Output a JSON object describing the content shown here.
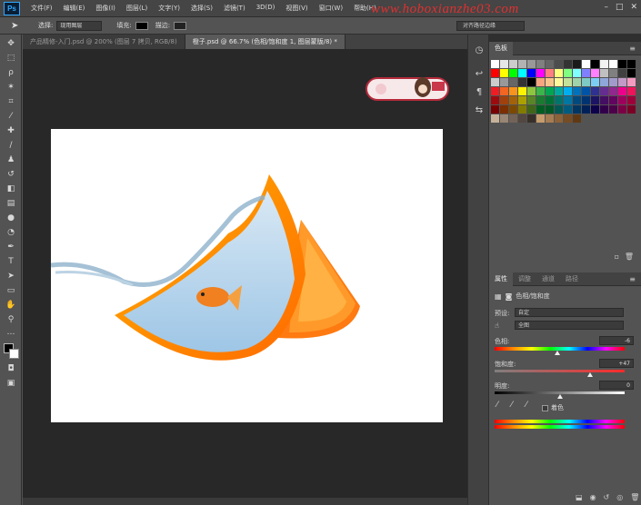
{
  "app": {
    "logo": "Ps",
    "watermark": "www.hoboxianzhe03.com"
  },
  "menu": [
    "文件(F)",
    "编辑(E)",
    "图像(I)",
    "图层(L)",
    "文字(Y)",
    "选择(S)",
    "滤镜(T)",
    "3D(D)",
    "视图(V)",
    "窗口(W)",
    "帮助(H)"
  ],
  "options": {
    "select_label": "选择:",
    "select_value": "现用图层",
    "fill_label": "填充:",
    "stroke_label": "描边:",
    "right_field": "对齐路径边缘"
  },
  "tabs": [
    {
      "label": "产品精修-入门.psd @ 200% (图层 7 拷贝, RGB/8)"
    },
    {
      "label": "橙子.psd @ 66.7% (色相/饱和度 1, 图层蒙版/8) *",
      "active": true
    }
  ],
  "swatches_panel": {
    "tab": "色板"
  },
  "swatch_colors": [
    "#ffffff",
    "#e6e6e6",
    "#cccccc",
    "#b3b3b3",
    "#999999",
    "#808080",
    "#666666",
    "#4d4d4d",
    "#333333",
    "#1a1a1a",
    "#ffffff",
    "#000000",
    "#f2f2f2",
    "#ffffff",
    "#000000",
    "#000000",
    "#ff0000",
    "#ffff00",
    "#00ff00",
    "#00ffff",
    "#0000ff",
    "#ff00ff",
    "#ff8080",
    "#ffff80",
    "#80ff80",
    "#80ffff",
    "#8080ff",
    "#ff80ff",
    "#c0c0c0",
    "#808080",
    "#404040",
    "#000000",
    "#cccccc",
    "#999999",
    "#666666",
    "#333333",
    "#000000",
    "#f5a57f",
    "#f7c58b",
    "#fff79a",
    "#c3e199",
    "#9fd3a9",
    "#7dcbc4",
    "#7ccdf4",
    "#8fa6d8",
    "#a39acc",
    "#c299c7",
    "#f39ac1",
    "#ee1d24",
    "#f26522",
    "#f7941d",
    "#fff200",
    "#8dc63f",
    "#39b54a",
    "#00a651",
    "#00a99d",
    "#00aeef",
    "#0072bc",
    "#0054a6",
    "#2e3192",
    "#662d91",
    "#92278f",
    "#ec008c",
    "#ed145b",
    "#9e0b0f",
    "#a0410d",
    "#a36209",
    "#aba000",
    "#598527",
    "#1a7b30",
    "#007236",
    "#00746b",
    "#0076a3",
    "#004a80",
    "#003471",
    "#1b1464",
    "#440e62",
    "#630460",
    "#9e005d",
    "#9e0039",
    "#790000",
    "#7b2e00",
    "#7d4900",
    "#827b00",
    "#406618",
    "#005e20",
    "#005826",
    "#005952",
    "#005b7f",
    "#003663",
    "#002157",
    "#0d004c",
    "#32004b",
    "#4b0049",
    "#7b0046",
    "#7a0026",
    "#c7b299",
    "#998675",
    "#736357",
    "#534741",
    "#37302a",
    "#c69c6d",
    "#a67c52",
    "#8c6239",
    "#754c24",
    "#603913"
  ],
  "properties": {
    "tabs": [
      "属性",
      "调整",
      "通道",
      "路径"
    ],
    "title": "色相/饱和度",
    "preset_label": "预设:",
    "preset_value": "自定",
    "channel_value": "全图",
    "hue_label": "色相:",
    "hue_value": "-6",
    "saturation_label": "饱和度:",
    "saturation_value": "+47",
    "lightness_label": "明度:",
    "lightness_value": "0",
    "colorize_label": "着色"
  },
  "sliders": {
    "hue": -6,
    "saturation": 47,
    "lightness": 0
  },
  "colors": {
    "accent": "#31a8ff",
    "watermark": "#e03030",
    "workspace": "#282828",
    "panel": "#535353"
  }
}
